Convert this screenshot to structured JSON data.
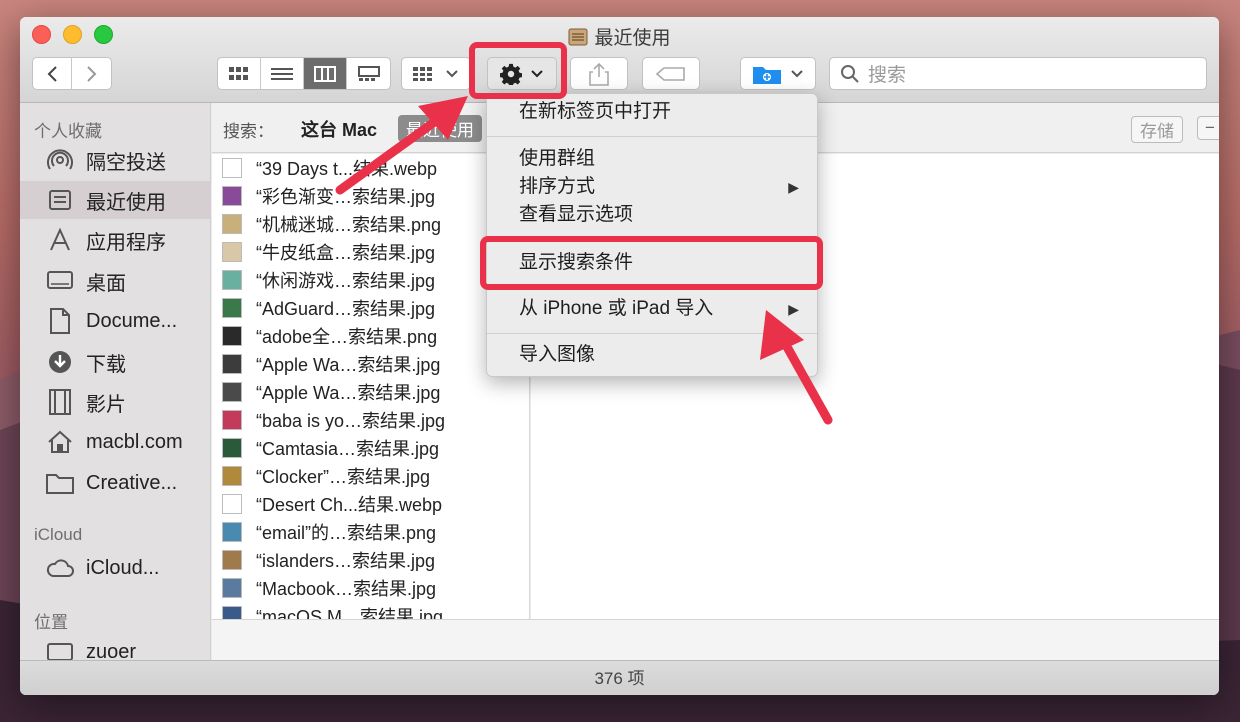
{
  "window": {
    "title": "最近使用"
  },
  "toolbar": {
    "search_placeholder": "搜索",
    "view_buttons": [
      "icon-view",
      "list-view",
      "column-view",
      "gallery-view"
    ],
    "active_view": "column-view"
  },
  "sidebar": {
    "favorites_header": "个人收藏",
    "favorites": [
      {
        "label": "隔空投送",
        "icon": "airdrop-icon"
      },
      {
        "label": "最近使用",
        "icon": "recents-icon",
        "selected": true
      },
      {
        "label": "应用程序",
        "icon": "applications-icon"
      },
      {
        "label": "桌面",
        "icon": "desktop-icon"
      },
      {
        "label": "Docume...",
        "icon": "documents-icon"
      },
      {
        "label": "下载",
        "icon": "downloads-icon"
      },
      {
        "label": "影片",
        "icon": "movies-icon"
      },
      {
        "label": "macbl.com",
        "icon": "home-icon"
      },
      {
        "label": "Creative...",
        "icon": "folder-icon"
      }
    ],
    "icloud_header": "iCloud",
    "icloud": [
      {
        "label": "iCloud...",
        "icon": "cloud-icon"
      }
    ],
    "locations_header": "位置",
    "locations": [
      {
        "label": "zuoer",
        "icon": "disk-icon"
      }
    ]
  },
  "scope": {
    "label": "搜索：",
    "this_mac": "这台 Mac",
    "recent_tab": "最近使用",
    "save_button": "存储",
    "remove_button": "−"
  },
  "files": [
    {
      "name": "“39 Days t...结果.webp",
      "thumb": "#ffffff"
    },
    {
      "name": "“彩色渐变…索结果.jpg",
      "thumb": "#8a4a9a"
    },
    {
      "name": "“机械迷城…索结果.png",
      "thumb": "#c9b07a"
    },
    {
      "name": "“牛皮纸盒…索结果.jpg",
      "thumb": "#d9c8a8"
    },
    {
      "name": "“休闲游戏…索结果.jpg",
      "thumb": "#6ab0a0"
    },
    {
      "name": "“AdGuard…索结果.jpg",
      "thumb": "#3a7a4a"
    },
    {
      "name": "“adobe全…索结果.png",
      "thumb": "#2a2a2a"
    },
    {
      "name": "“Apple Wa…索结果.jpg",
      "thumb": "#3c3c3c"
    },
    {
      "name": "“Apple Wa…索结果.jpg",
      "thumb": "#4a4a4a"
    },
    {
      "name": "“baba is yo…索结果.jpg",
      "thumb": "#c43a5a"
    },
    {
      "name": "“Camtasia…索结果.jpg",
      "thumb": "#2a5a3a"
    },
    {
      "name": "“Clocker”…索结果.jpg",
      "thumb": "#b08a3a"
    },
    {
      "name": "“Desert Ch...结果.webp",
      "thumb": "#ffffff"
    },
    {
      "name": "“email”的…索结果.png",
      "thumb": "#4a8ab0"
    },
    {
      "name": "“islanders…索结果.jpg",
      "thumb": "#a07a4a"
    },
    {
      "name": "“Macbook…索结果.jpg",
      "thumb": "#5a7aa0"
    },
    {
      "name": "“macOS M…索结果.jpg",
      "thumb": "#3a5a8a"
    }
  ],
  "context_menu": {
    "items": [
      {
        "label": "在新标签页中打开",
        "submenu": false
      },
      {
        "label": "使用群组",
        "submenu": false
      },
      {
        "label": "排序方式",
        "submenu": true
      },
      {
        "label": "查看显示选项",
        "submenu": false
      },
      {
        "label": "显示搜索条件",
        "submenu": false
      },
      {
        "label": "从 iPhone 或 iPad 导入",
        "submenu": true
      },
      {
        "label": "导入图像",
        "submenu": false
      }
    ],
    "submenu_arrow": "▶"
  },
  "status": {
    "item_count": "376 项"
  },
  "annotation_color": "#e9324a"
}
